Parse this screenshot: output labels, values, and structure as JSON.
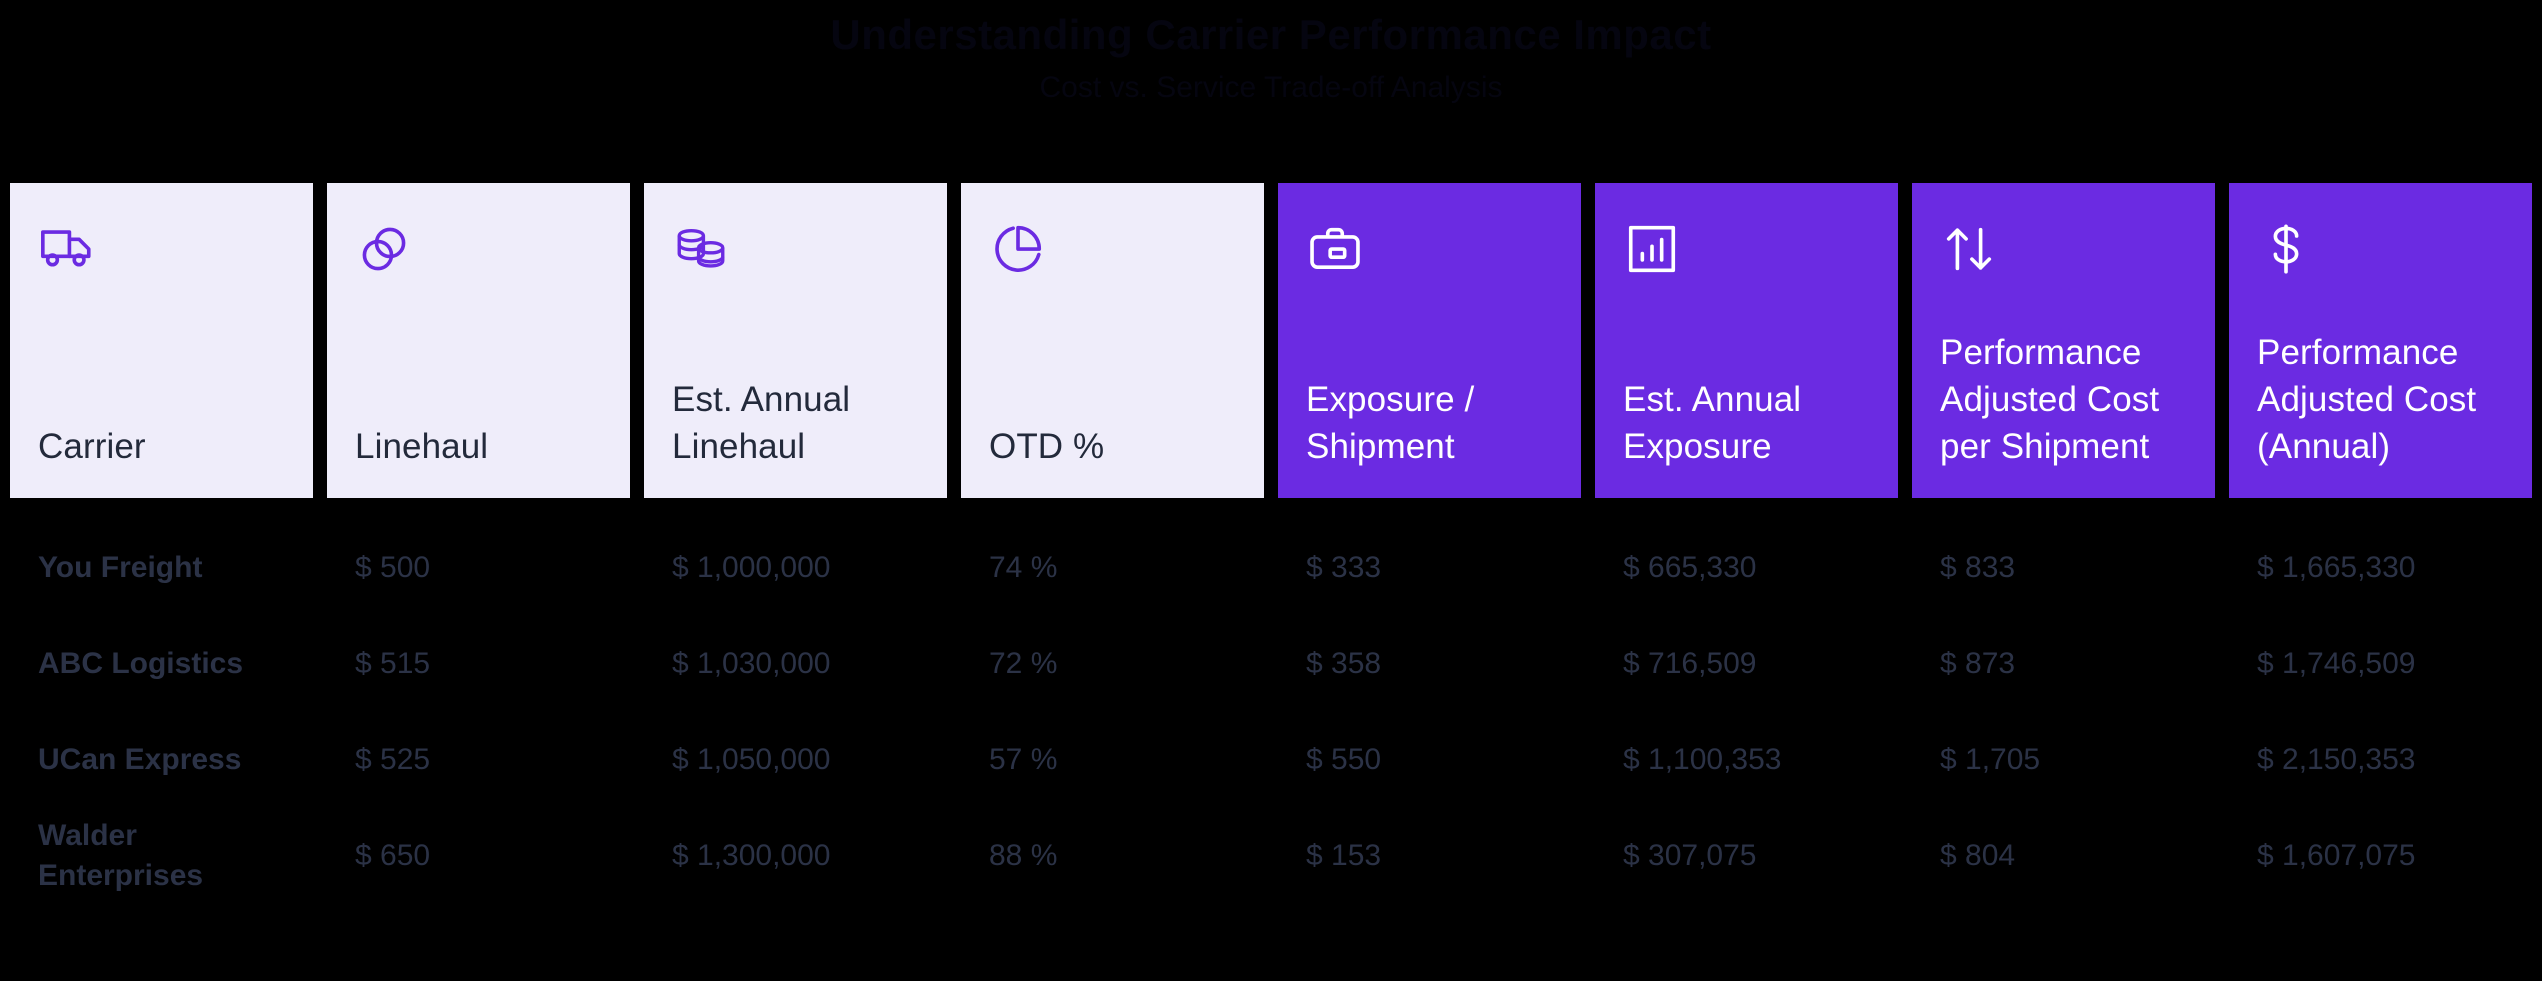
{
  "deck": {
    "title": "Understanding Carrier Performance Impact",
    "subtitle": "Cost vs. Service Trade-off Analysis"
  },
  "colors": {
    "background": "#000000",
    "card_light_bg": "#EFEDFA",
    "card_accent_bg": "#6B2BE2",
    "accent_purple": "#6B2BE2",
    "label_dark": "#232A3B",
    "label_light": "#FFFFFF",
    "data_text": "#2B3246"
  },
  "columns": [
    {
      "label": "Carrier",
      "icon": "truck-icon",
      "style": "light"
    },
    {
      "label": "Linehaul",
      "icon": "coins-circles-icon",
      "style": "light"
    },
    {
      "label": "Est. Annual Linehaul",
      "icon": "coin-stacks-icon",
      "style": "light"
    },
    {
      "label": "OTD %",
      "icon": "pie-chart-icon",
      "style": "light"
    },
    {
      "label": "Exposure / Shipment",
      "icon": "briefcase-icon",
      "style": "accent"
    },
    {
      "label": "Est. Annual Exposure",
      "icon": "bar-chart-icon",
      "style": "accent"
    },
    {
      "label": "Performance Adjusted Cost per Shipment",
      "icon": "arrows-up-down-icon",
      "style": "accent"
    },
    {
      "label": "Performance Adjusted Cost (Annual)",
      "icon": "dollar-sign-icon",
      "style": "accent"
    }
  ],
  "rows": [
    {
      "carrier": "You Freight",
      "linehaul": "$ 500",
      "annual_linehaul": "$ 1,000,000",
      "otd": "74 %",
      "exposure_per_shipment": "$ 333",
      "annual_exposure": "$ 665,330",
      "pac_per_shipment": "$ 833",
      "pac_annual": "$ 1,665,330"
    },
    {
      "carrier": "ABC Logistics",
      "linehaul": "$ 515",
      "annual_linehaul": "$ 1,030,000",
      "otd": "72 %",
      "exposure_per_shipment": "$ 358",
      "annual_exposure": "$ 716,509",
      "pac_per_shipment": "$ 873",
      "pac_annual": "$ 1,746,509"
    },
    {
      "carrier": "UCan Express",
      "linehaul": "$ 525",
      "annual_linehaul": "$ 1,050,000",
      "otd": "57 %",
      "exposure_per_shipment": "$ 550",
      "annual_exposure": "$ 1,100,353",
      "pac_per_shipment": "$ 1,705",
      "pac_annual": "$ 2,150,353"
    },
    {
      "carrier": "Walder Enterprises",
      "linehaul": "$ 650",
      "annual_linehaul": "$ 1,300,000",
      "otd": "88 %",
      "exposure_per_shipment": "$ 153",
      "annual_exposure": "$ 307,075",
      "pac_per_shipment": "$ 804",
      "pac_annual": "$ 1,607,075"
    }
  ]
}
